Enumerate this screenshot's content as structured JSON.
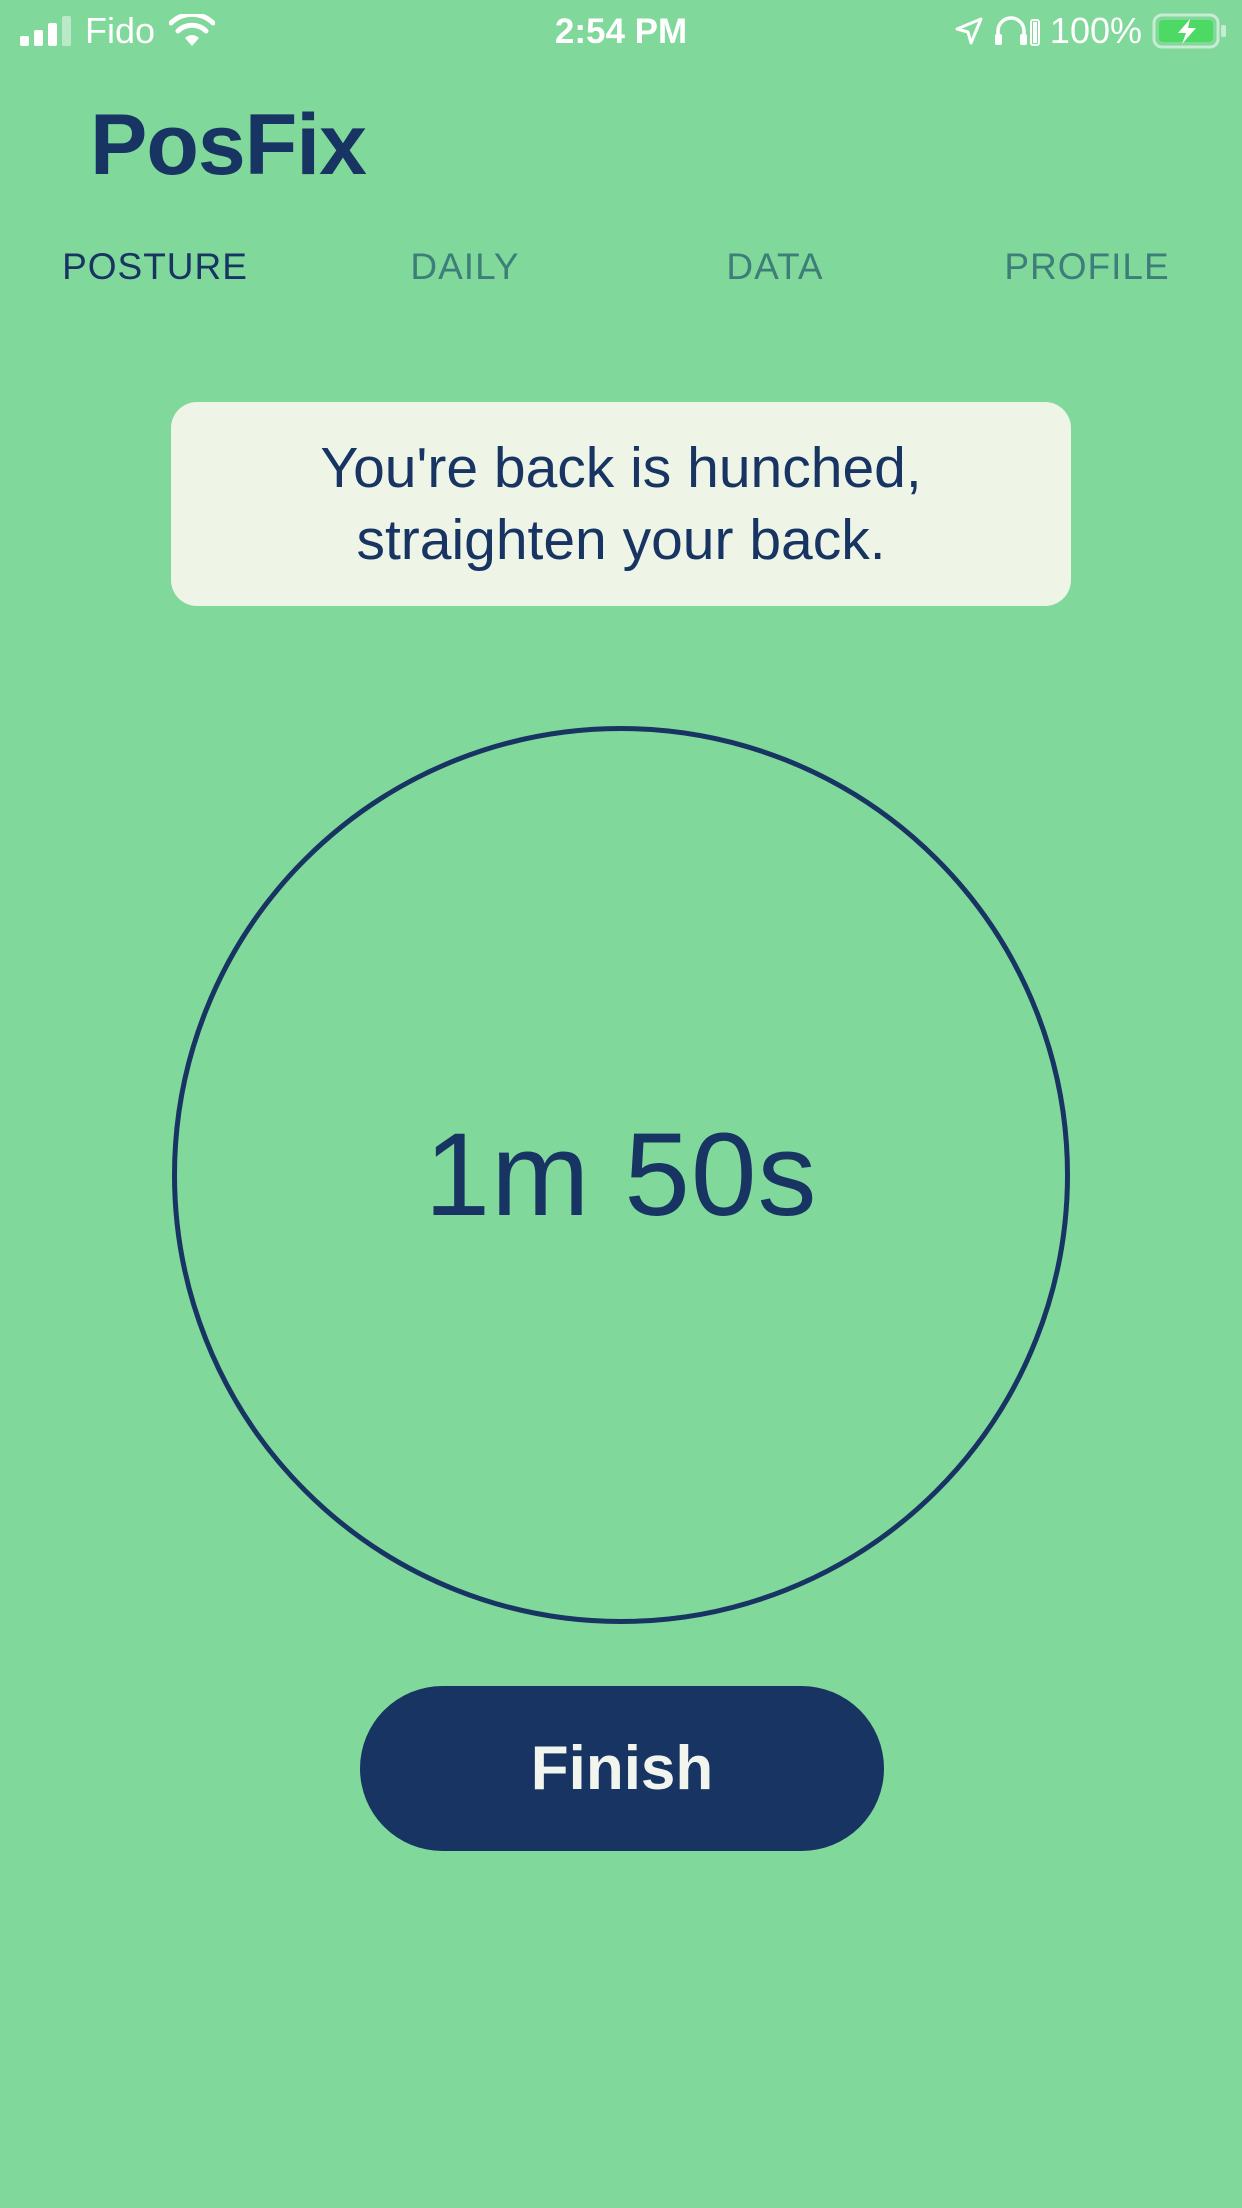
{
  "status_bar": {
    "carrier": "Fido",
    "time": "2:54 PM",
    "battery_percent": "100%",
    "icons": [
      "signal-icon",
      "wifi-icon",
      "location-arrow-icon",
      "headphones-battery-icon",
      "battery-charging-icon"
    ],
    "signal_bars_active": 3,
    "signal_bars_total": 4,
    "battery_level": 1.0
  },
  "app": {
    "title": "PosFix"
  },
  "tabs": [
    {
      "label": "POSTURE",
      "active": true
    },
    {
      "label": "DAILY",
      "active": false
    },
    {
      "label": "DATA",
      "active": false
    },
    {
      "label": "PROFILE",
      "active": false
    }
  ],
  "message": {
    "line1": "You're back is hunched,",
    "line2": "straighten your back."
  },
  "timer": {
    "display": "1m 50s"
  },
  "actions": {
    "finish_label": "Finish"
  },
  "colors": {
    "background": "#80d89a",
    "primary": "#173463",
    "inactive_tab": "#3d7e7a",
    "card_background": "#eef5e6",
    "button_text": "#f2f5ee",
    "battery_fill": "#4cd964"
  }
}
